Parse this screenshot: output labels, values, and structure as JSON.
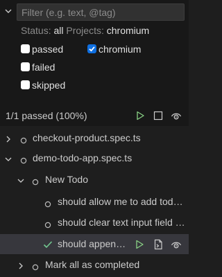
{
  "filter": {
    "placeholder": "Filter (e.g. text, @tag)",
    "value": ""
  },
  "status": {
    "status_label": "Status:",
    "status_value": "all",
    "projects_label": "Projects:",
    "projects_value": "chromium"
  },
  "checkboxes": [
    {
      "label": "passed",
      "checked": false
    },
    {
      "label": "chromium",
      "checked": true
    },
    {
      "label": "failed",
      "checked": false
    },
    {
      "label": "skipped",
      "checked": false
    }
  ],
  "summary": {
    "text": "1/1 passed (100%)"
  },
  "toolbar": {
    "icons": [
      "run-icon",
      "stop-icon",
      "watch-icon"
    ]
  },
  "tree": [
    {
      "label": "checkout-product.spec.ts",
      "state": "collapsed",
      "status": "not-run"
    },
    {
      "label": "demo-todo-app.spec.ts",
      "state": "expanded",
      "status": "not-run"
    },
    {
      "label": "New Todo",
      "state": "expanded",
      "status": "not-run"
    },
    {
      "label": "should allow me to add todo items",
      "status": "not-run"
    },
    {
      "label": "should clear text input field when an item is added",
      "status": "not-run"
    },
    {
      "label": "should append new items to the bottom of the list",
      "status": "passed",
      "selected": true,
      "actions": [
        "run-icon",
        "go-to-file-icon",
        "watch-icon"
      ]
    },
    {
      "label": "Mark all as completed",
      "state": "collapsed",
      "status": "not-run"
    }
  ],
  "colors": {
    "background": "#1e1e1e",
    "panel": "#181818",
    "selected_row": "#37373d",
    "passed_green": "#73c991",
    "run_green": "#89d185",
    "checkbox_blue": "#0f6fe0"
  }
}
